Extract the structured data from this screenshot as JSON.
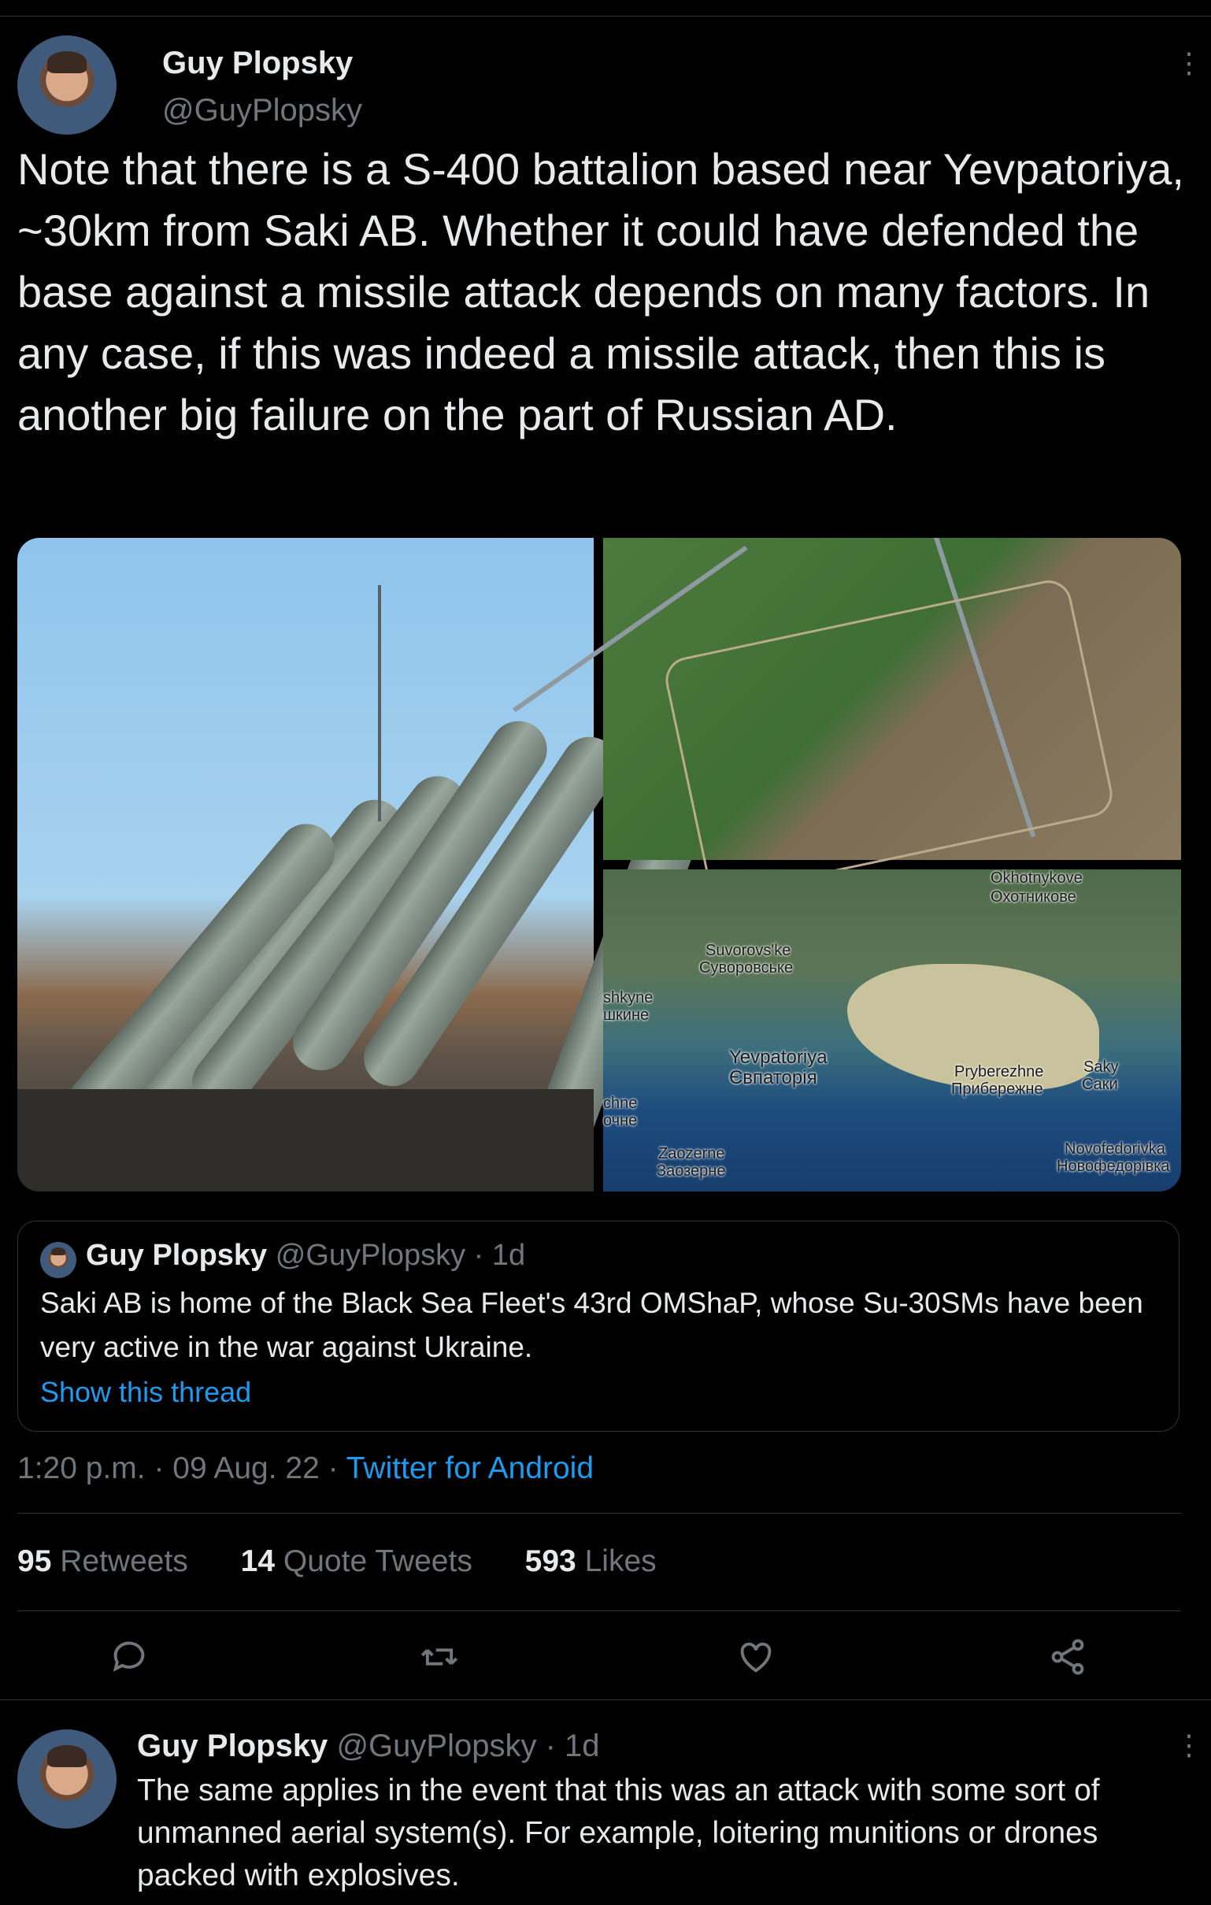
{
  "main_tweet": {
    "author_name": "Guy Plopsky",
    "author_handle": "@GuyPlopsky",
    "text": "Note that there is a S-400 battalion based near Yevpatoriya, ~30km from Saki AB. Whether it could have defended the base against a missile attack depends on many factors. In any case, if this was indeed a missile attack, then this is another big failure on the part of Russian AD.",
    "map_labels": {
      "okhotnykove_en": "Okhotnykove",
      "okhotnykove_uk": "Охотникове",
      "suvorovske_en": "Suvorovs'ke",
      "suvorovske_uk": "Суворовське",
      "shkyne_en": "shkyne",
      "shkyne_uk": "шкине",
      "yevpatoriya_en": "Yevpatoriya",
      "yevpatoriya_uk": "Євпаторія",
      "pryberezhne_en": "Pryberezhne",
      "pryberezhne_uk": "Прибережне",
      "saky_en": "Saky",
      "saky_uk": "Саки",
      "chne_en": "chne",
      "chne_uk": "очне",
      "zaozerne_en": "Zaozerne",
      "zaozerne_uk": "Заозерне",
      "novofedorivka_en": "Novofedorivka",
      "novofedorivka_uk": "Новофедорівка"
    },
    "quoted": {
      "author_name": "Guy Plopsky",
      "author_handle": "@GuyPlopsky",
      "age": "· 1d",
      "text": "Saki AB is home of the Black Sea Fleet's 43rd OMShaP, whose Su-30SMs have been very active in the war against Ukraine.",
      "show_thread": "Show this thread"
    },
    "time": "1:20 p.m.",
    "date": "· 09 Aug. 22 ·",
    "source": "Twitter for Android",
    "stats": {
      "retweets_count": "95",
      "retweets_label": "Retweets",
      "quotes_count": "14",
      "quotes_label": "Quote Tweets",
      "likes_count": "593",
      "likes_label": "Likes"
    },
    "actions": [
      "reply-icon",
      "retweet-icon",
      "like-icon",
      "share-icon"
    ]
  },
  "reply": {
    "author_name": "Guy Plopsky",
    "author_handle": "@GuyPlopsky",
    "age": "· 1d",
    "text": "The same applies in the event that this was an attack with some sort of unmanned aerial system(s). For example, loitering munitions or drones packed with explosives."
  },
  "colors": {
    "background": "#000000",
    "text": "#e7e9ea",
    "muted": "#71767b",
    "accent": "#1d9bf0",
    "border": "#2f3336"
  }
}
